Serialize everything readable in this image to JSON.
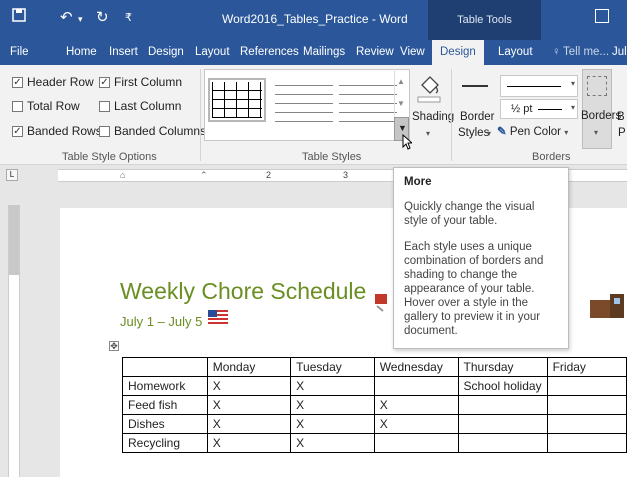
{
  "titlebar": {
    "save_icon": "save-icon",
    "undo_icon": "undo-icon",
    "redo_icon": "redo-icon",
    "qat_dropdown": "qat-dropdown-icon",
    "doc_title": "Word2016_Tables_Practice - Word",
    "context_tab_group": "Table Tools",
    "restore_icon": "ribbon-display-options-icon"
  },
  "tabs": [
    {
      "label": "File"
    },
    {
      "label": "Home"
    },
    {
      "label": "Insert"
    },
    {
      "label": "Design"
    },
    {
      "label": "Layout"
    },
    {
      "label": "References"
    },
    {
      "label": "Mailings"
    },
    {
      "label": "Review"
    },
    {
      "label": "View"
    },
    {
      "label": "Design"
    },
    {
      "label": "Layout"
    },
    {
      "label": "Tell me..."
    },
    {
      "label": "Jul"
    }
  ],
  "ribbon": {
    "table_style_options": {
      "header_row": "Header Row",
      "first_column": "First Column",
      "total_row": "Total Row",
      "last_column": "Last Column",
      "banded_rows": "Banded Rows",
      "banded_columns": "Banded Columns",
      "group_label": "Table Style Options",
      "checked": {
        "header_row": true,
        "first_column": true,
        "total_row": false,
        "last_column": false,
        "banded_rows": true,
        "banded_columns": false
      }
    },
    "table_styles": {
      "group_label": "Table Styles",
      "shading_label": "Shading"
    },
    "borders": {
      "border_styles_line1": "Border",
      "border_styles_line2": "Styles",
      "line_weight": "½ pt",
      "pen_color": "Pen Color",
      "borders_button": "Borders",
      "group_label": "Borders",
      "partial_label1": "B",
      "partial_label2": "P"
    }
  },
  "ruler": {
    "numbers": [
      "2",
      "3"
    ]
  },
  "document": {
    "title": "Weekly Chore Schedule",
    "date_range": "July 1 – July 5",
    "table": {
      "headers": [
        "",
        "Monday",
        "Tuesday",
        "Wednesday",
        "Thursday",
        "Friday"
      ],
      "rows": [
        [
          "Homework",
          "X",
          "X",
          "",
          "School holiday",
          ""
        ],
        [
          "Feed fish",
          "X",
          "X",
          "X",
          "",
          ""
        ],
        [
          "Dishes",
          "X",
          "X",
          "X",
          "",
          ""
        ],
        [
          "Recycling",
          "X",
          "X",
          "",
          "",
          ""
        ]
      ]
    }
  },
  "tooltip": {
    "title": "More",
    "body1": "Quickly change the visual style of your table.",
    "body2": "Each style uses a unique combination of borders and shading to change the appearance of your table. Hover over a style in the gallery to preview it in your document."
  },
  "colors": {
    "title_bar": "#2b579a",
    "table_tools": "#1f3f73",
    "doc_heading": "#6b8e23"
  }
}
